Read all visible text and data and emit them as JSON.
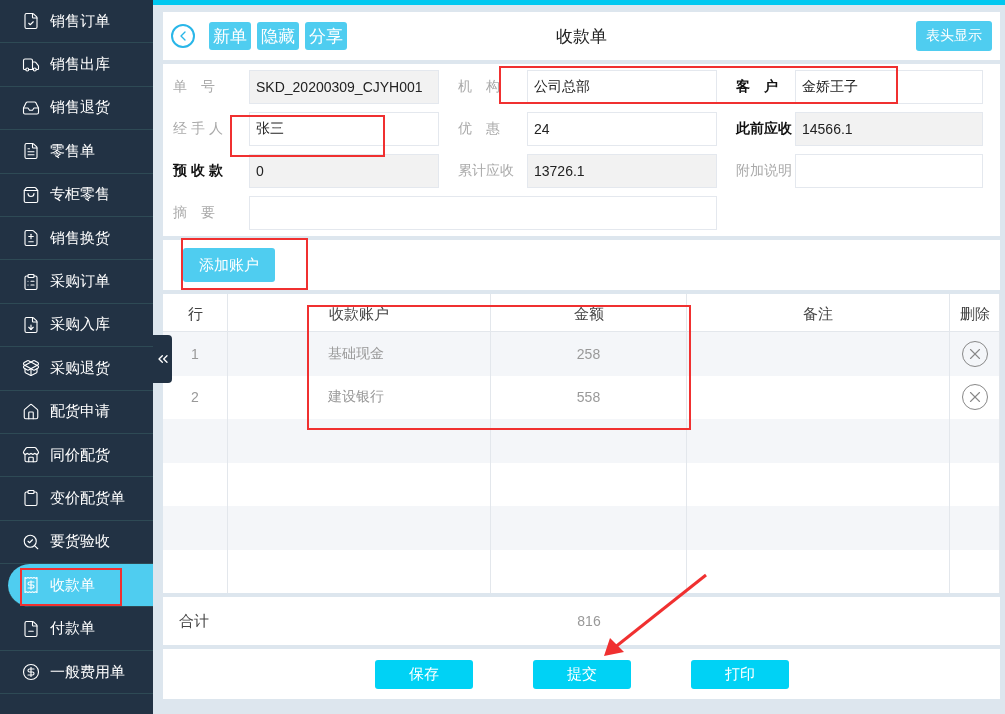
{
  "sidebar": {
    "items": [
      {
        "label": "销售订单",
        "selected": false
      },
      {
        "label": "销售出库",
        "selected": false
      },
      {
        "label": "销售退货",
        "selected": false
      },
      {
        "label": "零售单",
        "selected": false
      },
      {
        "label": "专柜零售",
        "selected": false
      },
      {
        "label": "销售换货",
        "selected": false
      },
      {
        "label": "采购订单",
        "selected": false
      },
      {
        "label": "采购入库",
        "selected": false
      },
      {
        "label": "采购退货",
        "selected": false
      },
      {
        "label": "配货申请",
        "selected": false
      },
      {
        "label": "同价配货",
        "selected": false
      },
      {
        "label": "变价配货单",
        "selected": false
      },
      {
        "label": "要货验收",
        "selected": false
      },
      {
        "label": "收款单",
        "selected": true
      },
      {
        "label": "付款单",
        "selected": false
      },
      {
        "label": "一般费用单",
        "selected": false
      }
    ]
  },
  "toolbar": {
    "buttons": [
      "新单",
      "隐藏",
      "分享"
    ],
    "title": "收款单",
    "header_toggle": "表头显示"
  },
  "form": {
    "fields": [
      {
        "label": "单　号",
        "value": "SKD_20200309_CJYH001",
        "emphasis": false,
        "readonly": true
      },
      {
        "label": "机　构",
        "value": "公司总部",
        "emphasis": false,
        "readonly": false
      },
      {
        "label": "客　户",
        "value": "金娇王子",
        "emphasis": true,
        "readonly": false
      },
      {
        "label": "经 手 人",
        "value": "张三",
        "emphasis": false,
        "readonly": false
      },
      {
        "label": "优　惠",
        "value": "24",
        "emphasis": false,
        "readonly": false
      },
      {
        "label": "此前应收",
        "value": "14566.1",
        "emphasis": true,
        "readonly": true
      },
      {
        "label": "预 收 款",
        "value": "0",
        "emphasis": true,
        "readonly": true
      },
      {
        "label": "累计应收",
        "value": "13726.1",
        "emphasis": false,
        "readonly": true
      },
      {
        "label": "附加说明",
        "emphasis": false,
        "readonly": false
      },
      {
        "label": "摘　要",
        "emphasis": false,
        "readonly": false
      }
    ]
  },
  "add_account": "添加账户",
  "table": {
    "columns": [
      "行",
      "收款账户",
      "金额",
      "备注",
      "删除"
    ],
    "rows": [
      {
        "line": "1",
        "account": "基础现金",
        "amount": "258"
      },
      {
        "line": "2",
        "account": "建设银行",
        "amount": "558"
      }
    ],
    "total": {
      "label": "合计",
      "amount": "816"
    }
  },
  "footer": {
    "buttons": [
      "保存",
      "提交",
      "打印"
    ]
  },
  "annotations": [
    {
      "kind": "box"
    },
    {
      "kind": "box"
    },
    {
      "kind": "box"
    },
    {
      "kind": "box"
    },
    {
      "kind": "box"
    },
    {
      "kind": "arrow"
    }
  ]
}
